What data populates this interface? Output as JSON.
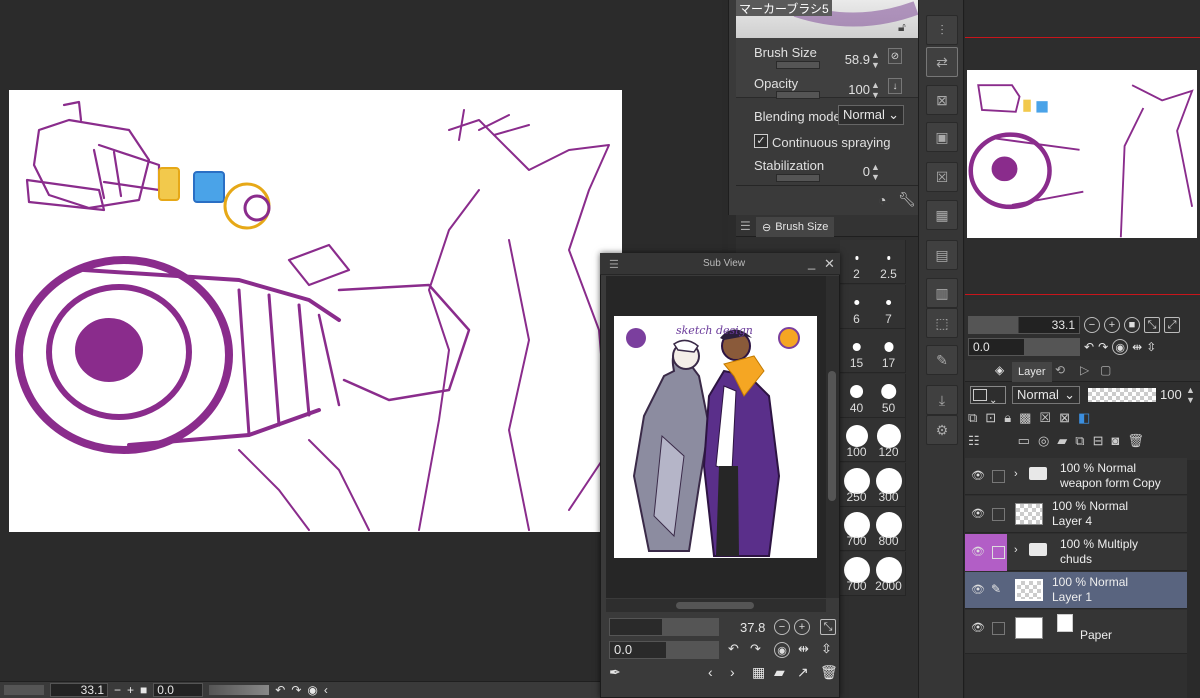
{
  "tool_property": {
    "brush_name": "マーカーブラシ5",
    "brush_size_label": "Brush Size",
    "brush_size_value": "58.9",
    "opacity_label": "Opacity",
    "opacity_value": "100",
    "blending_mode_label": "Blending mode",
    "blending_mode_value": "Normal",
    "continuous_spraying_label": "Continuous spraying",
    "continuous_spraying_checked": true,
    "stabilization_label": "Stabilization",
    "stabilization_value": "0"
  },
  "brush_size_palette": {
    "tab_label": "Brush Size",
    "sizes": [
      "2",
      "2.5",
      "6",
      "7",
      "15",
      "17",
      "40",
      "50",
      "100",
      "120",
      "250",
      "300",
      "700",
      "800",
      "700",
      "2000"
    ]
  },
  "sub_view": {
    "title": "Sub View",
    "zoom_value": "37.8",
    "rotation_value": "0.0",
    "image_text": "sketch design"
  },
  "navigator": {
    "zoom_value": "33.1",
    "rotation_value": "0.0"
  },
  "layer_panel": {
    "tab_label": "Layer",
    "blend_mode": "Normal",
    "opacity": "100",
    "layers": [
      {
        "line1": "100 % Normal",
        "line2": "weapon form Copy",
        "type": "folder",
        "selected": false
      },
      {
        "line1": "100 % Normal",
        "line2": "Layer 4",
        "type": "raster",
        "selected": false
      },
      {
        "line1": "100 % Multiply",
        "line2": "chuds",
        "type": "folder",
        "selected": false
      },
      {
        "line1": "100 % Normal",
        "line2": "Layer 1",
        "type": "raster",
        "selected": true
      },
      {
        "line1": "",
        "line2": "Paper",
        "type": "paper",
        "selected": false
      }
    ]
  },
  "status_bar": {
    "zoom_value": "33.1",
    "rotation_value": "0.0"
  },
  "colors": {
    "accent_purple": "#8a2c8c",
    "selected_layer": "#59647f",
    "navigator_red_line": "#c8151b"
  }
}
